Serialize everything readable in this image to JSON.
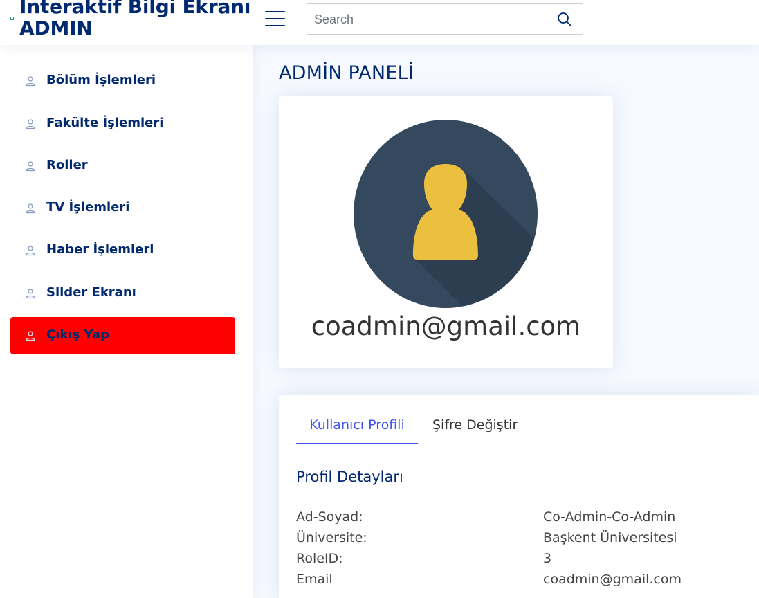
{
  "header": {
    "brand_line1": "İnteraktif Bilgi Ekranı",
    "brand_line2": "ADMIN",
    "menu_icon": "hamburger-icon",
    "search": {
      "placeholder": "Search",
      "value": "",
      "icon": "search-icon"
    }
  },
  "sidebar": {
    "items": [
      {
        "label": "Bölüm İşlemleri",
        "icon": "person-icon"
      },
      {
        "label": "Fakülte İşlemleri",
        "icon": "person-icon"
      },
      {
        "label": "Roller",
        "icon": "person-icon"
      },
      {
        "label": "TV İşlemleri",
        "icon": "person-icon"
      },
      {
        "label": "Haber İşlemleri",
        "icon": "person-icon"
      },
      {
        "label": "Slider Ekranı",
        "icon": "person-icon"
      },
      {
        "label": "Çıkış Yap",
        "icon": "person-icon",
        "highlight_color": "#ff0000"
      }
    ]
  },
  "main": {
    "page_title": "ADMİN PANELİ",
    "profile": {
      "avatar_icon": "user-avatar-icon",
      "email": "coadmin@gmail.com"
    },
    "tabs": [
      {
        "label": "Kullanıcı Profili",
        "active": true
      },
      {
        "label": "Şifre Değiştir",
        "active": false
      }
    ],
    "details": {
      "title": "Profil Detayları",
      "rows": [
        {
          "label": "Ad-Soyad:",
          "value": "Co-Admin-Co-Admin"
        },
        {
          "label": "Üniversite:",
          "value": "Başkent Üniversitesi"
        },
        {
          "label": "RoleID:",
          "value": "3"
        },
        {
          "label": "Email",
          "value": "coadmin@gmail.com"
        }
      ]
    }
  },
  "colors": {
    "brand": "#012970",
    "accent": "#4154f1",
    "logout": "#ff0000",
    "avatar_bg": "#34495e",
    "avatar_figure": "#ebc03f"
  }
}
